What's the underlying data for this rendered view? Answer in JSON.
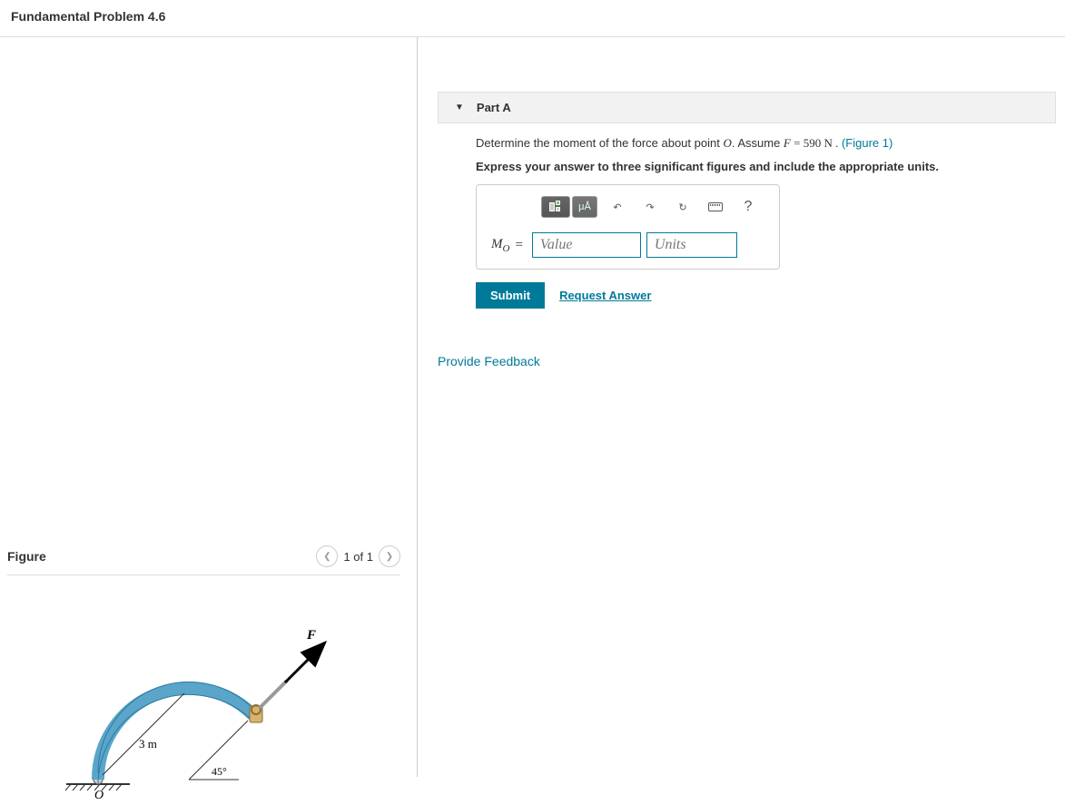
{
  "header": {
    "title": "Fundamental Problem 4.6"
  },
  "figure": {
    "title": "Figure",
    "nav_text": "1 of 1",
    "labels": {
      "force": "F",
      "radius": "3 m",
      "angle": "45°",
      "origin": "O"
    }
  },
  "part": {
    "title": "Part A",
    "question_prefix": "Determine the moment of the force about point ",
    "question_point": "O",
    "question_mid": ". Assume ",
    "force_var": "F",
    "force_value": " = 590 N .",
    "figure_link": "(Figure 1)",
    "instruction": "Express your answer to three significant figures and include the appropriate units.",
    "toolbar": {
      "units_btn": "μÅ",
      "help": "?"
    },
    "answer": {
      "label": "M",
      "subscript": "O",
      "equals": "=",
      "value_placeholder": "Value",
      "units_placeholder": "Units"
    },
    "submit_label": "Submit",
    "request_label": "Request Answer"
  },
  "feedback_link": "Provide Feedback"
}
